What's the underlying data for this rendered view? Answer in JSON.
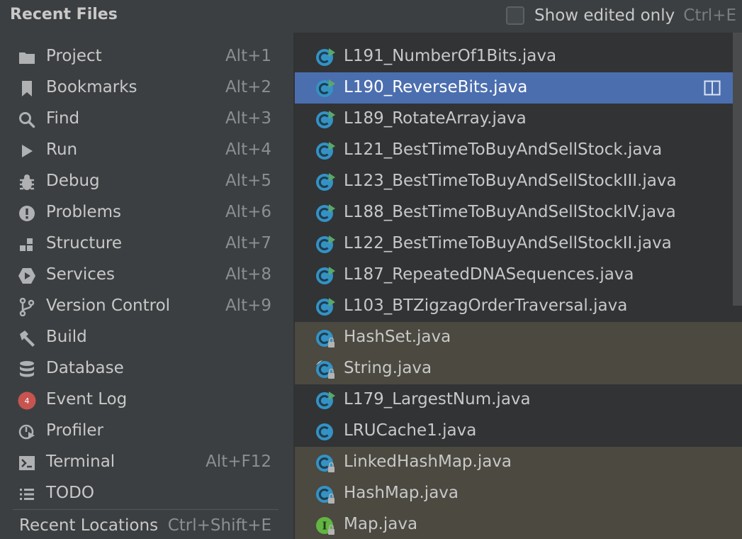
{
  "header": {
    "title": "Recent Files",
    "option_label": "Show edited only",
    "option_shortcut": "Ctrl+E",
    "option_checked": false
  },
  "nav": {
    "items": [
      {
        "label": "Project",
        "shortcut": "Alt+1",
        "icon": "folder-icon"
      },
      {
        "label": "Bookmarks",
        "shortcut": "Alt+2",
        "icon": "bookmark-icon"
      },
      {
        "label": "Find",
        "shortcut": "Alt+3",
        "icon": "search-icon"
      },
      {
        "label": "Run",
        "shortcut": "Alt+4",
        "icon": "play-icon"
      },
      {
        "label": "Debug",
        "shortcut": "Alt+5",
        "icon": "bug-icon"
      },
      {
        "label": "Problems",
        "shortcut": "Alt+6",
        "icon": "exclamation-icon"
      },
      {
        "label": "Structure",
        "shortcut": "Alt+7",
        "icon": "structure-icon"
      },
      {
        "label": "Services",
        "shortcut": "Alt+8",
        "icon": "services-icon"
      },
      {
        "label": "Version Control",
        "shortcut": "Alt+9",
        "icon": "branch-icon"
      },
      {
        "label": "Build",
        "shortcut": "",
        "icon": "hammer-icon"
      },
      {
        "label": "Database",
        "shortcut": "",
        "icon": "database-icon"
      },
      {
        "label": "Event Log",
        "shortcut": "",
        "icon": "event-log-icon",
        "badge": "4"
      },
      {
        "label": "Profiler",
        "shortcut": "",
        "icon": "profiler-icon"
      },
      {
        "label": "Terminal",
        "shortcut": "Alt+F12",
        "icon": "terminal-icon"
      },
      {
        "label": "TODO",
        "shortcut": "",
        "icon": "list-icon"
      }
    ],
    "recent_locations": "Recent Locations",
    "recent_locations_shortcut": "Ctrl+Shift+E"
  },
  "files": [
    {
      "name": "L191_NumberOf1Bits.java",
      "kind": "runnable",
      "bg": "plain"
    },
    {
      "name": "L190_ReverseBits.java",
      "kind": "runnable",
      "bg": "sel"
    },
    {
      "name": "L189_RotateArray.java",
      "kind": "runnable",
      "bg": "plain"
    },
    {
      "name": "L121_BestTimeToBuyAndSellStock.java",
      "kind": "runnable",
      "bg": "plain"
    },
    {
      "name": "L123_BestTimeToBuyAndSellStockIII.java",
      "kind": "runnable",
      "bg": "plain"
    },
    {
      "name": "L188_BestTimeToBuyAndSellStockIV.java",
      "kind": "runnable",
      "bg": "plain"
    },
    {
      "name": "L122_BestTimeToBuyAndSellStockII.java",
      "kind": "runnable",
      "bg": "plain"
    },
    {
      "name": "L187_RepeatedDNASequences.java",
      "kind": "runnable",
      "bg": "plain"
    },
    {
      "name": "L103_BTZigzagOrderTraversal.java",
      "kind": "runnable",
      "bg": "plain"
    },
    {
      "name": "HashSet.java",
      "kind": "locked",
      "bg": "lib"
    },
    {
      "name": "String.java",
      "kind": "locked-final",
      "bg": "lib"
    },
    {
      "name": "L179_LargestNum.java",
      "kind": "runnable",
      "bg": "plain"
    },
    {
      "name": "LRUCache1.java",
      "kind": "class",
      "bg": "plain"
    },
    {
      "name": "LinkedHashMap.java",
      "kind": "locked",
      "bg": "lib"
    },
    {
      "name": "HashMap.java",
      "kind": "locked",
      "bg": "lib"
    },
    {
      "name": "Map.java",
      "kind": "interface-locked",
      "bg": "lib"
    }
  ],
  "colors": {
    "panel": "#3c3f41",
    "list": "#313335",
    "selection": "#4b6eaf",
    "library": "#4b4940",
    "class_icon": "#3592c4",
    "interface_icon": "#62b543",
    "run_arrow": "#59a869"
  }
}
